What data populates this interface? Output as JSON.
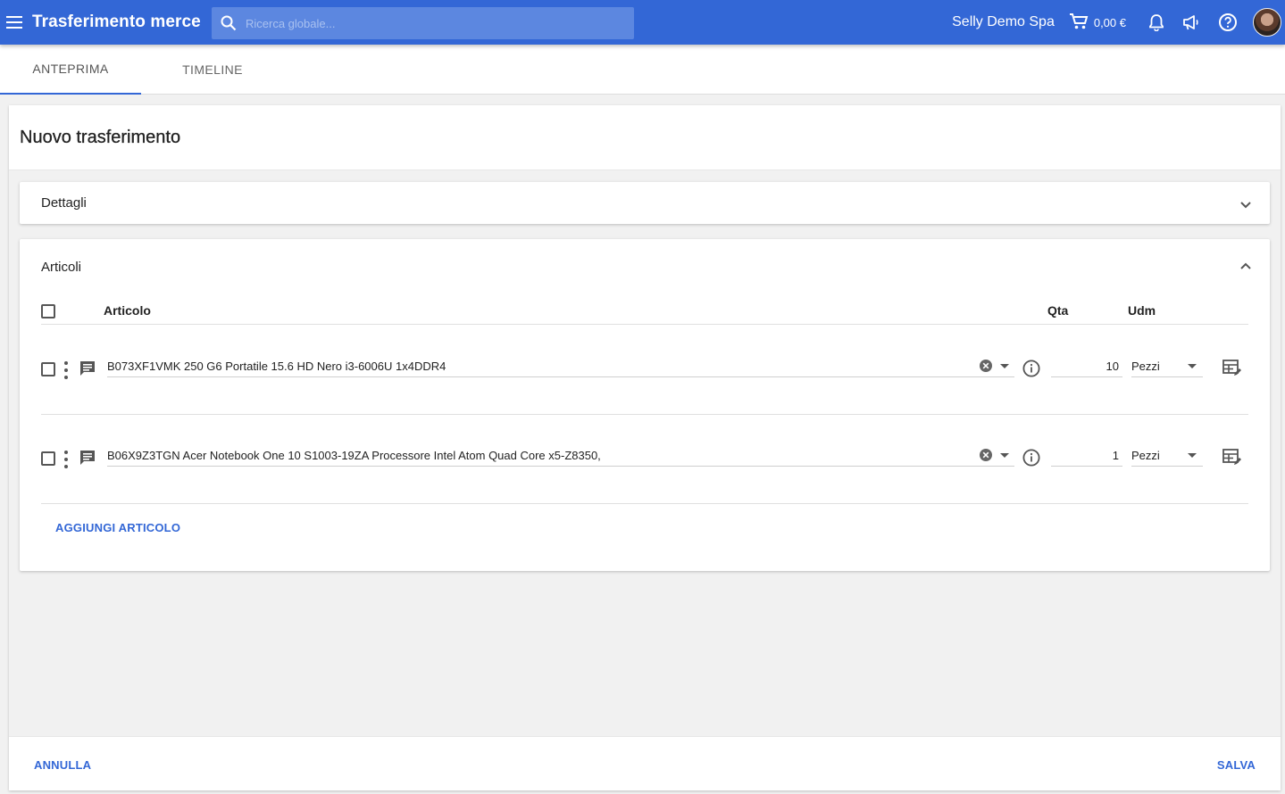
{
  "app": {
    "title": "Trasferimento merce"
  },
  "search": {
    "placeholder": "Ricerca globale..."
  },
  "header": {
    "company": "Selly Demo Spa",
    "cart_total": "0,00 €",
    "icons": [
      "menu-icon",
      "search-icon",
      "cart-icon",
      "bell-icon",
      "megaphone-icon",
      "help-icon"
    ]
  },
  "tabs": [
    {
      "label": "ANTEPRIMA",
      "active": true
    },
    {
      "label": "TIMELINE",
      "active": false
    }
  ],
  "page": {
    "title": "Nuovo trasferimento"
  },
  "details": {
    "title": "Dettagli",
    "expanded": false
  },
  "articles": {
    "title": "Articoli",
    "expanded": true,
    "columns": {
      "article": "Articolo",
      "qty": "Qta",
      "uom": "Udm"
    },
    "items": [
      {
        "article": "B073XF1VMK 250 G6 Portatile 15.6 HD Nero i3-6006U 1x4DDR4",
        "qty": "10",
        "uom": "Pezzi"
      },
      {
        "article": "B06X9Z3TGN Acer Notebook One 10 S1003-19ZA Processore Intel Atom Quad Core x5-Z8350,",
        "qty": "1",
        "uom": "Pezzi"
      }
    ],
    "add_label": "AGGIUNGI ARTICOLO"
  },
  "footer": {
    "cancel_label": "ANNULLA",
    "save_label": "SALVA"
  },
  "colors": {
    "primary": "#3367d6",
    "search_bg": "#5c87e0"
  }
}
